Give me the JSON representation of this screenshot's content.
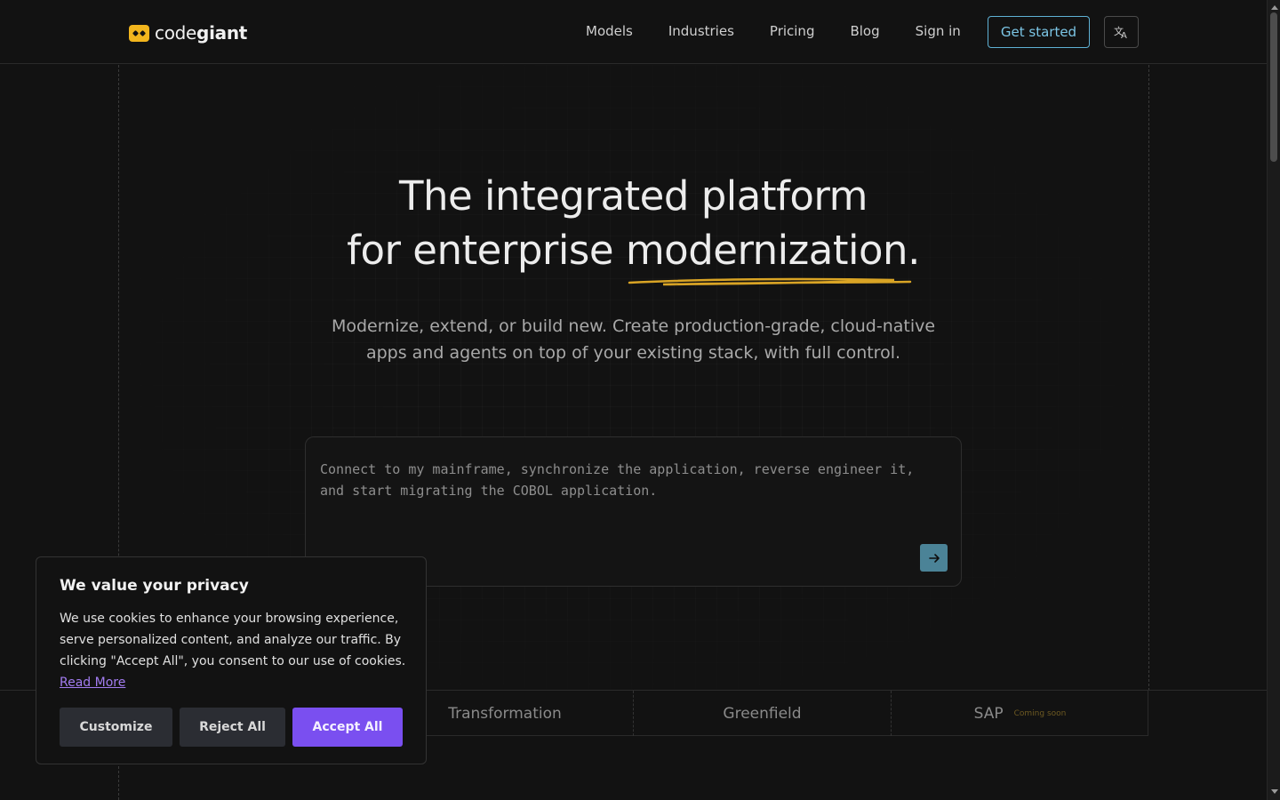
{
  "header": {
    "logo_text_light": "code",
    "logo_text_bold": "giant",
    "nav": [
      {
        "label": "Models"
      },
      {
        "label": "Industries"
      },
      {
        "label": "Pricing"
      },
      {
        "label": "Blog"
      },
      {
        "label": "Sign in"
      }
    ],
    "cta_label": "Get started",
    "lang_icon": "translate-icon"
  },
  "hero": {
    "title_line1": "The integrated platform",
    "title_line2_prefix": "for enterprise ",
    "title_line2_accent": "modernization.",
    "subtitle": "Modernize, extend, or build new. Create production-grade, cloud-native apps and agents on top of your existing stack, with full control."
  },
  "prompt": {
    "placeholder": "Connect to my mainframe, synchronize the application, reverse engineer it, and start migrating the COBOL application.",
    "send_icon": "arrow-right-icon"
  },
  "tabs": [
    {
      "label": "Transformation"
    },
    {
      "label": "Greenfield"
    },
    {
      "label": "SAP",
      "badge": "Coming soon"
    }
  ],
  "cookie": {
    "title": "We value your privacy",
    "text": "We use cookies to enhance your browsing experience, serve personalized content, and analyze our traffic. By clicking \"Accept All\", you consent to our use of cookies.",
    "read_more": "Read More",
    "customize_label": "Customize",
    "reject_label": "Reject All",
    "accept_label": "Accept All"
  },
  "colors": {
    "background": "#121212",
    "cta_border": "#5fb1d4",
    "accent_underline": "#d9a425",
    "send_button": "#4b8397",
    "accept_button": "#7a4ff0",
    "logo": "#f2b51d"
  }
}
